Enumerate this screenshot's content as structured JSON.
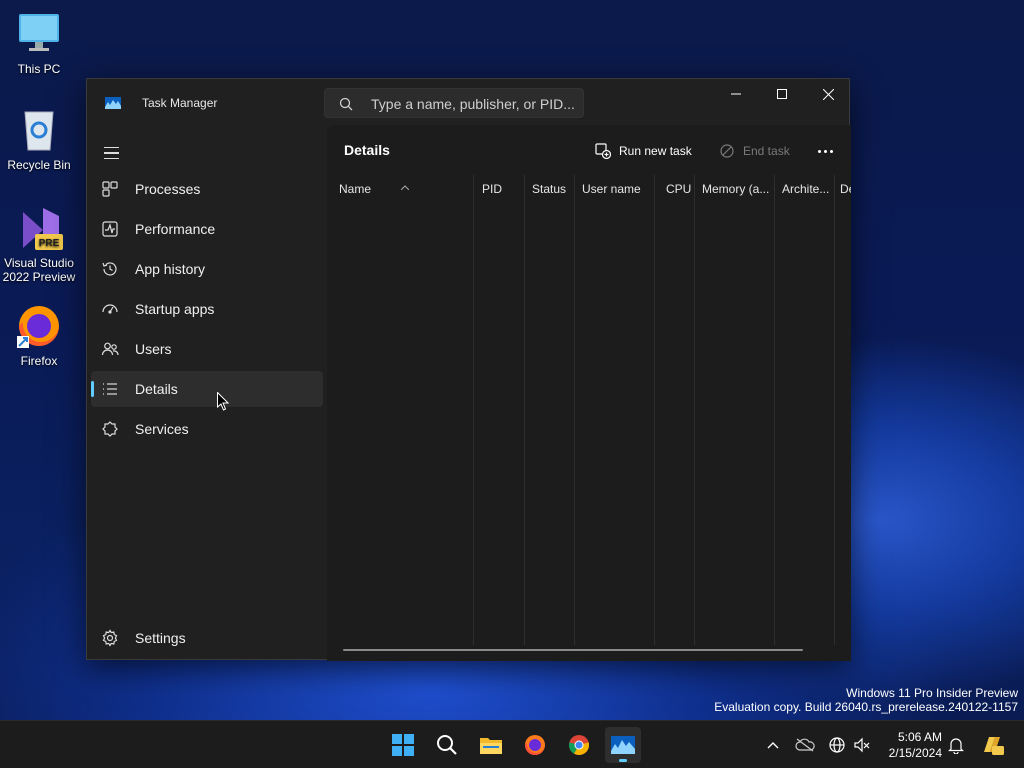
{
  "desktop": {
    "icons": [
      {
        "label": "This PC"
      },
      {
        "label": "Recycle Bin"
      },
      {
        "label_line1": "Visual Studio",
        "label_line2": "2022 Preview",
        "badge": "PRE"
      },
      {
        "label": "Firefox"
      }
    ]
  },
  "window": {
    "title": "Task Manager",
    "search_placeholder": "Type a name, publisher, or PID..."
  },
  "sidebar": {
    "items": [
      {
        "label": "Processes",
        "icon": "processes-icon"
      },
      {
        "label": "Performance",
        "icon": "performance-icon"
      },
      {
        "label": "App history",
        "icon": "app-history-icon"
      },
      {
        "label": "Startup apps",
        "icon": "startup-apps-icon"
      },
      {
        "label": "Users",
        "icon": "users-icon"
      },
      {
        "label": "Details",
        "icon": "details-icon",
        "active": true
      },
      {
        "label": "Services",
        "icon": "services-icon"
      }
    ],
    "settings_label": "Settings"
  },
  "content": {
    "title": "Details",
    "run_new_task": "Run new task",
    "end_task": "End task",
    "columns": [
      "Name",
      "PID",
      "Status",
      "User name",
      "CPU",
      "Memory (a...",
      "Archite...",
      "De"
    ]
  },
  "watermark": {
    "line1": "Windows 11 Pro Insider Preview",
    "line2": "Evaluation copy. Build 26040.rs_prerelease.240122-1157"
  },
  "taskbar": {
    "time": "5:06 AM",
    "date": "2/15/2024"
  },
  "colors": {
    "accent": "#60cdff",
    "window_bg": "#202020",
    "content_bg": "#1c1c1c"
  }
}
